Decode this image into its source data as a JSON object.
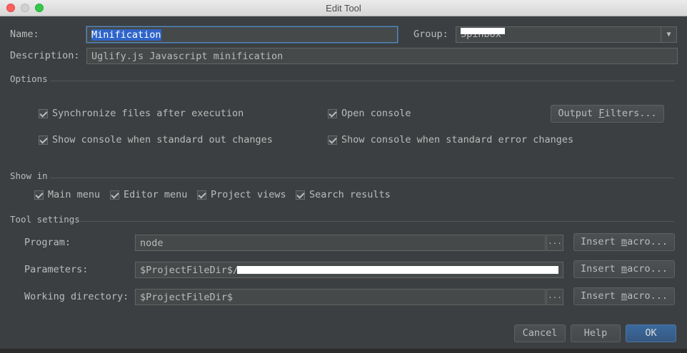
{
  "window": {
    "title": "Edit Tool"
  },
  "name": {
    "label": "Name:",
    "value": "Minification"
  },
  "group": {
    "label": "Group:",
    "value": "Spinbox"
  },
  "description": {
    "label": "Description:",
    "value": "Uglify.js Javascript minification"
  },
  "options": {
    "title": "Options",
    "synchronize": "Synchronize files after execution",
    "open_console": "Open console",
    "output_filters_pre": "Output ",
    "output_filters_u": "F",
    "output_filters_post": "ilters...",
    "console_stdout": "Show console when standard out changes",
    "console_stderr": "Show console when standard error changes"
  },
  "show_in": {
    "title": "Show in",
    "main_menu": "Main menu",
    "editor_menu": "Editor menu",
    "project_views": "Project views",
    "search_results": "Search results"
  },
  "tool_settings": {
    "title": "Tool settings",
    "program_label": "Program:",
    "program_value": "node",
    "parameters_label": "Parameters:",
    "parameters_value": "$ProjectFileDir$/",
    "working_dir_label": "Working directory:",
    "working_dir_value": "$ProjectFileDir$",
    "browse": "...",
    "insert_macro_pre": "Insert ",
    "insert_macro_u": "m",
    "insert_macro_post": "acro..."
  },
  "buttons": {
    "cancel": "Cancel",
    "help": "Help",
    "ok": "OK"
  }
}
